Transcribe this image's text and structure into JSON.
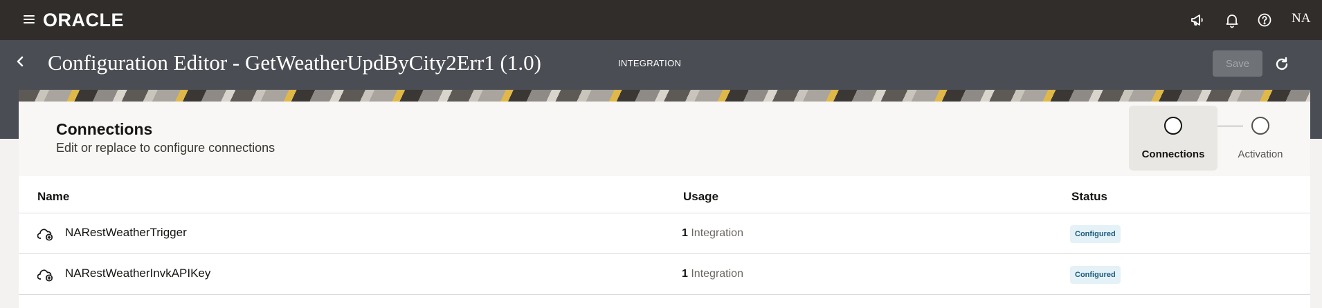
{
  "topbar": {
    "brand": "ORACLE",
    "icons": [
      "hamburger-menu-icon",
      "megaphone-icon",
      "bell-icon",
      "help-icon"
    ],
    "user_initials": "NA"
  },
  "header": {
    "title": "Configuration Editor - GetWeatherUpdByCity2Err1 (1.0)",
    "type_label": "INTEGRATION",
    "save_label": "Save"
  },
  "section": {
    "title": "Connections",
    "subtitle": "Edit or replace to configure connections"
  },
  "steps": [
    {
      "label": "Connections",
      "active": true
    },
    {
      "label": "Activation",
      "active": false
    }
  ],
  "table": {
    "columns": [
      "Name",
      "Usage",
      "Status"
    ],
    "rows": [
      {
        "name": "NARestWeatherTrigger",
        "usage_count": "1",
        "usage_unit": "Integration",
        "status": "Configured"
      },
      {
        "name": "NARestWeatherInvkAPIKey",
        "usage_count": "1",
        "usage_unit": "Integration",
        "status": "Configured"
      }
    ]
  },
  "colors": {
    "topbar": "#312d2a",
    "header": "#4a4d53",
    "badge_bg": "#e4f1f7",
    "badge_text": "#1c5b7d"
  }
}
